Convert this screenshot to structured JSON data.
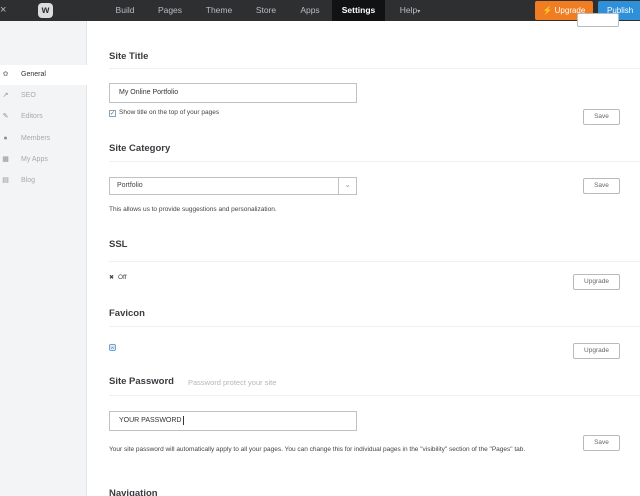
{
  "topbar": {
    "close_glyph": "×",
    "logo_glyph": "w",
    "nav": [
      {
        "label": "Build",
        "active": false
      },
      {
        "label": "Pages",
        "active": false
      },
      {
        "label": "Theme",
        "active": false
      },
      {
        "label": "Store",
        "active": false
      },
      {
        "label": "Apps",
        "active": false
      },
      {
        "label": "Settings",
        "active": true
      },
      {
        "label": "Help",
        "active": false
      }
    ],
    "help_caret": "▾",
    "upgrade_label": "Upgrade",
    "publish_label": "Publish"
  },
  "sidebar": {
    "items": [
      {
        "label": "General",
        "icon": "gear-icon",
        "glyph": "✿",
        "active": true
      },
      {
        "label": "SEO",
        "icon": "trend-icon",
        "glyph": "↗",
        "active": false
      },
      {
        "label": "Editors",
        "icon": "pencil-icon",
        "glyph": "✎",
        "active": false
      },
      {
        "label": "Members",
        "icon": "person-icon",
        "glyph": "●",
        "active": false
      },
      {
        "label": "My Apps",
        "icon": "grid-icon",
        "glyph": "▦",
        "active": false
      },
      {
        "label": "Blog",
        "icon": "chat-icon",
        "glyph": "▤",
        "active": false
      }
    ]
  },
  "site_title": {
    "heading": "Site Title",
    "value": "My Online Portfolio",
    "checkbox_checked": true,
    "checkbox_glyph": "✓",
    "checkbox_label": "Show title on the top of your pages",
    "save_label": "Save"
  },
  "site_category": {
    "heading": "Site Category",
    "selected": "Portfolio",
    "caret": "⌄",
    "help_text": "This allows us to provide suggestions and personalization.",
    "save_label": "Save"
  },
  "ssl": {
    "heading": "SSL",
    "status_glyph": "✖",
    "status_text": "Off",
    "upgrade_label": "Upgrade"
  },
  "favicon": {
    "heading": "Favicon",
    "icon_glyph": "W",
    "upgrade_label": "Upgrade"
  },
  "site_password": {
    "heading": "Site Password",
    "subtitle": "Password protect your site",
    "value": "YOUR PASSWORD",
    "help_text": "Your site password will automatically apply to all your pages. You can change this for individual pages in the \"visibility\" section of the \"Pages\" tab.",
    "save_label": "Save"
  },
  "navigation": {
    "heading": "Navigation"
  }
}
